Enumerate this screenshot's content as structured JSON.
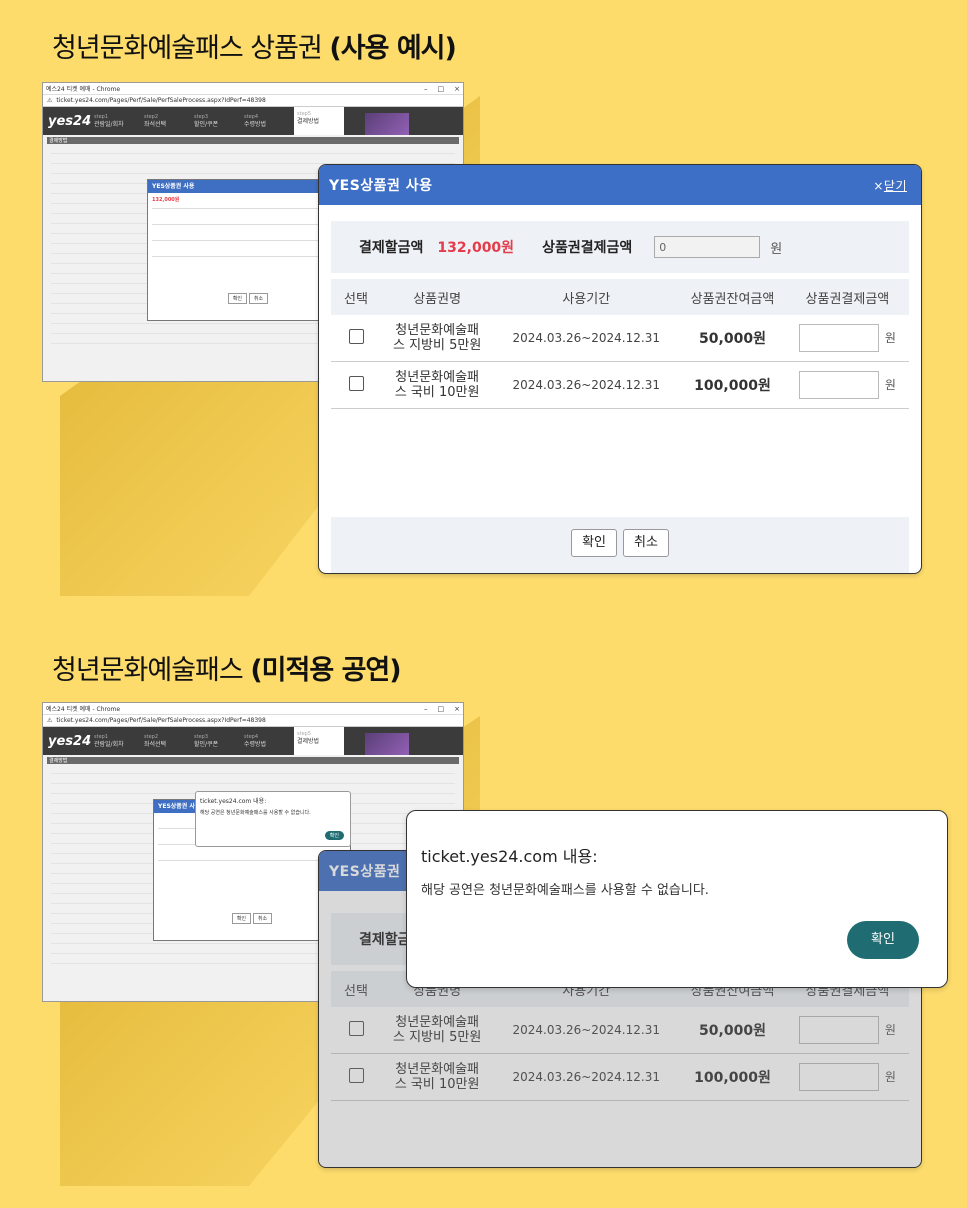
{
  "section1": {
    "title_normal": "청년문화예술패스 상품권 ",
    "title_bold": "(사용 예시)"
  },
  "section2": {
    "title_normal": "청년문화예술패스 ",
    "title_bold": "(미적용 공연)"
  },
  "mini": {
    "window_title": "예스24 티켓 예매 - Chrome",
    "address": "ticket.yes24.com/Pages/Perf/Sale/PerfSaleProcess.aspx?IdPerf=48398",
    "logo": "yes24",
    "steps": [
      {
        "small": "step1",
        "label": "관람일/회차"
      },
      {
        "small": "step2",
        "label": "좌석선택"
      },
      {
        "small": "step3",
        "label": "할인/쿠폰"
      },
      {
        "small": "step4",
        "label": "수령방법"
      },
      {
        "small": "step5",
        "label": "결제방법"
      }
    ],
    "panel_label": "결제방법",
    "mini_dialog_title": "YES상품권 사용",
    "mini_pay_amount": "132,000원",
    "mini_confirm": "확인",
    "mini_cancel": "취소",
    "mini_alert_title": "ticket.yes24.com 내용:",
    "mini_alert_msg": "해당 공연은 청년문화예술패스를 사용할 수 없습니다.",
    "mini_alert_ok": "확인"
  },
  "dialog": {
    "title": "YES상품권 사용",
    "close_x": "×",
    "close_label": "닫기",
    "pay_label": "결제할금액",
    "pay_amount": "132,000원",
    "voucher_pay_label": "상품권결제금액",
    "voucher_pay_value": "0",
    "unit": "원",
    "columns": [
      "선택",
      "상품권명",
      "사용기간",
      "상품권잔여금액",
      "상품권결제금액"
    ],
    "rows": [
      {
        "name_line1": "청년문화예술패",
        "name_line2": "스 지방비 5만원",
        "period": "2024.03.26~2024.12.31",
        "balance": "50,000원",
        "unit": "원"
      },
      {
        "name_line1": "청년문화예술패",
        "name_line2": "스 국비 10만원",
        "period": "2024.03.26~2024.12.31",
        "balance": "100,000원",
        "unit": "원"
      }
    ],
    "confirm": "확인",
    "cancel": "취소"
  },
  "alert": {
    "title": "ticket.yes24.com 내용:",
    "message": "해당 공연은 청년문화예술패스를 사용할 수 없습니다.",
    "ok": "확인"
  }
}
